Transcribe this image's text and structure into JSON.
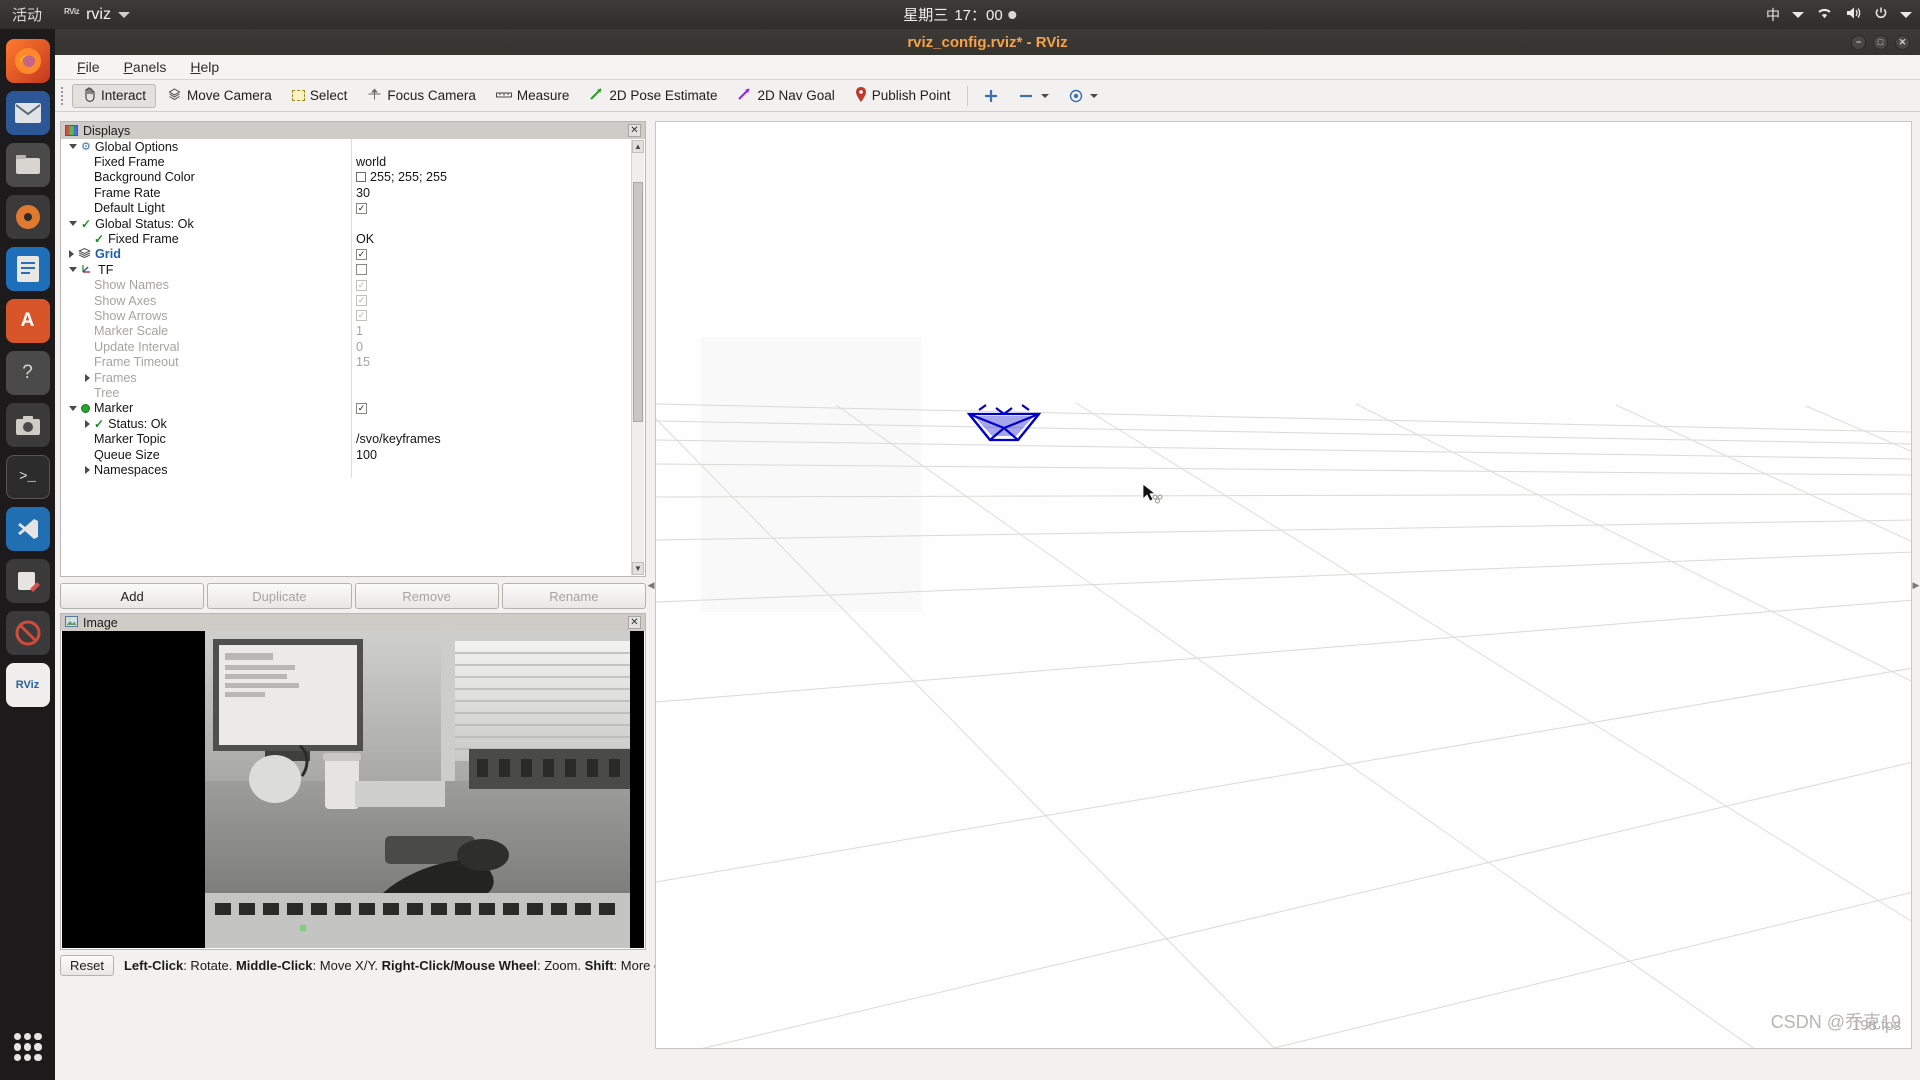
{
  "desktop": {
    "activities_label": "活动",
    "app_menu": {
      "icon": "rviz-app-icon",
      "name": "rviz"
    },
    "clock": {
      "day": "星期三",
      "time": "17：00"
    },
    "indicators": {
      "input_method": "中",
      "network": "wifi-icon",
      "volume": "volume-icon",
      "power": "power-icon",
      "menu": "chevron-down-icon"
    },
    "dock": [
      {
        "name": "firefox",
        "glyph": "🦊"
      },
      {
        "name": "thunderbird",
        "glyph": "✉"
      },
      {
        "name": "files",
        "glyph": "🗄"
      },
      {
        "name": "rhythmbox",
        "glyph": "◎"
      },
      {
        "name": "libreoffice-writer",
        "glyph": "📄"
      },
      {
        "name": "ubuntu-software",
        "glyph": "A"
      },
      {
        "name": "help",
        "glyph": "?"
      },
      {
        "name": "screenshot",
        "glyph": "📷"
      },
      {
        "name": "terminal",
        "glyph": ">_"
      },
      {
        "name": "vscode",
        "glyph": "X"
      },
      {
        "name": "text-editor",
        "glyph": "✎"
      },
      {
        "name": "forbidden",
        "glyph": "⊘"
      },
      {
        "name": "rviz",
        "glyph": "RViz"
      }
    ]
  },
  "window": {
    "title": "rviz_config.rviz* - RViz",
    "controls": {
      "minimize": "−",
      "maximize": "□",
      "close": "✕"
    }
  },
  "menubar": [
    {
      "label": "File",
      "mnemonic": "F"
    },
    {
      "label": "Panels",
      "mnemonic": "P"
    },
    {
      "label": "Help",
      "mnemonic": "H"
    }
  ],
  "toolbar": {
    "tools": [
      {
        "label": "Interact",
        "icon": "hand-cursor-icon",
        "active": true
      },
      {
        "label": "Move Camera",
        "icon": "move-camera-icon",
        "active": false
      },
      {
        "label": "Select",
        "icon": "select-rect-icon",
        "active": false
      },
      {
        "label": "Focus Camera",
        "icon": "focus-camera-icon",
        "active": false
      },
      {
        "label": "Measure",
        "icon": "measure-icon",
        "active": false
      },
      {
        "label": "2D Pose Estimate",
        "icon": "pose-estimate-icon",
        "active": false
      },
      {
        "label": "2D Nav Goal",
        "icon": "nav-goal-icon",
        "active": false
      },
      {
        "label": "Publish Point",
        "icon": "publish-point-icon",
        "active": false
      }
    ],
    "extra": [
      {
        "name": "add-tool-button",
        "glyph": "✛"
      },
      {
        "name": "remove-tool-button",
        "glyph": "▬"
      },
      {
        "name": "tool-properties-button",
        "glyph": "◉"
      }
    ]
  },
  "displays_panel": {
    "title": "Displays",
    "icon": "displays-monitor-icon",
    "close_label": "✕",
    "rows": [
      {
        "expander": "down",
        "icon": "gear",
        "name": "Global Options",
        "value": "",
        "indent": 0,
        "dim": false,
        "selected": false
      },
      {
        "expander": "none",
        "icon": "none",
        "name": "Fixed Frame",
        "value": "world",
        "indent": 1,
        "dim": false,
        "selected": false
      },
      {
        "expander": "none",
        "icon": "none",
        "name": "Background Color",
        "value": "255; 255; 255",
        "value_swatch": "#ffffff",
        "indent": 1,
        "dim": false,
        "selected": false
      },
      {
        "expander": "none",
        "icon": "none",
        "name": "Frame Rate",
        "value": "30",
        "indent": 1,
        "dim": false,
        "selected": false
      },
      {
        "expander": "none",
        "icon": "none",
        "name": "Default Light",
        "value": "checkbox-checked",
        "indent": 1,
        "dim": false,
        "selected": false
      },
      {
        "expander": "down",
        "icon": "tick",
        "name": "Global Status: Ok",
        "value": "",
        "indent": 0,
        "dim": false,
        "selected": false
      },
      {
        "expander": "none",
        "icon": "tick",
        "name": "Fixed Frame",
        "value": "OK",
        "indent": 1,
        "dim": false,
        "selected": false
      },
      {
        "expander": "right",
        "icon": "grid",
        "name": "Grid",
        "value": "checkbox-checked",
        "indent": 0,
        "dim": false,
        "selected": true
      },
      {
        "expander": "down",
        "icon": "tf",
        "name": "TF",
        "value": "checkbox-unchecked",
        "indent": 0,
        "dim": false,
        "selected": false
      },
      {
        "expander": "none",
        "icon": "none",
        "name": "Show Names",
        "value": "checkbox-checked-dim",
        "indent": 1,
        "dim": true,
        "selected": false
      },
      {
        "expander": "none",
        "icon": "none",
        "name": "Show Axes",
        "value": "checkbox-checked-dim",
        "indent": 1,
        "dim": true,
        "selected": false
      },
      {
        "expander": "none",
        "icon": "none",
        "name": "Show Arrows",
        "value": "checkbox-checked-dim",
        "indent": 1,
        "dim": true,
        "selected": false
      },
      {
        "expander": "none",
        "icon": "none",
        "name": "Marker Scale",
        "value": "1",
        "indent": 1,
        "dim": true,
        "selected": false
      },
      {
        "expander": "none",
        "icon": "none",
        "name": "Update Interval",
        "value": "0",
        "indent": 1,
        "dim": true,
        "selected": false
      },
      {
        "expander": "none",
        "icon": "none",
        "name": "Frame Timeout",
        "value": "15",
        "indent": 1,
        "dim": true,
        "selected": false
      },
      {
        "expander": "right",
        "icon": "none",
        "name": "Frames",
        "value": "",
        "indent": 1,
        "dim": true,
        "selected": false
      },
      {
        "expander": "none",
        "icon": "none",
        "name": "Tree",
        "value": "",
        "indent": 1,
        "dim": true,
        "selected": false
      },
      {
        "expander": "down",
        "icon": "greendot",
        "name": "Marker",
        "value": "checkbox-checked",
        "indent": 0,
        "dim": false,
        "selected": false
      },
      {
        "expander": "right",
        "icon": "tick",
        "name": "Status: Ok",
        "value": "",
        "indent": 1,
        "dim": false,
        "selected": false
      },
      {
        "expander": "none",
        "icon": "none",
        "name": "Marker Topic",
        "value": "/svo/keyframes",
        "indent": 1,
        "dim": false,
        "selected": false
      },
      {
        "expander": "none",
        "icon": "none",
        "name": "Queue Size",
        "value": "100",
        "indent": 1,
        "dim": false,
        "selected": false
      },
      {
        "expander": "right",
        "icon": "none",
        "name": "Namespaces",
        "value": "",
        "indent": 1,
        "dim": false,
        "selected": false
      }
    ],
    "buttons": [
      {
        "label": "Add",
        "enabled": true
      },
      {
        "label": "Duplicate",
        "enabled": false
      },
      {
        "label": "Remove",
        "enabled": false
      },
      {
        "label": "Rename",
        "enabled": false
      }
    ]
  },
  "image_panel": {
    "title": "Image",
    "icon": "image-panel-icon",
    "close_label": "✕",
    "content_description": "grayscale-camera-feed-desk-monitor-keyboard-hand"
  },
  "statusbar": {
    "reset_label": "Reset",
    "hints": [
      {
        "key": "Left-Click",
        "text": ": Rotate. "
      },
      {
        "key": "Middle-Click",
        "text": ": Move X/Y. "
      },
      {
        "key": "Right-Click/Mouse Wheel",
        "text": ": Zoom. "
      },
      {
        "key": "Shift",
        "text": ": More options."
      }
    ],
    "fps": "198 fps"
  },
  "viewport": {
    "marker_color": "#0000cc",
    "grid_color": "#d8d8d8",
    "background": "#ffffff",
    "cursor": "arrow-cursor",
    "watermark": "CSDN @乔克19"
  },
  "colors": {
    "accent_title": "#f6a24a",
    "selected_item": "#1a5fb4",
    "status_ok": "#1a8a2e",
    "marker_dot": "#23a52f"
  }
}
